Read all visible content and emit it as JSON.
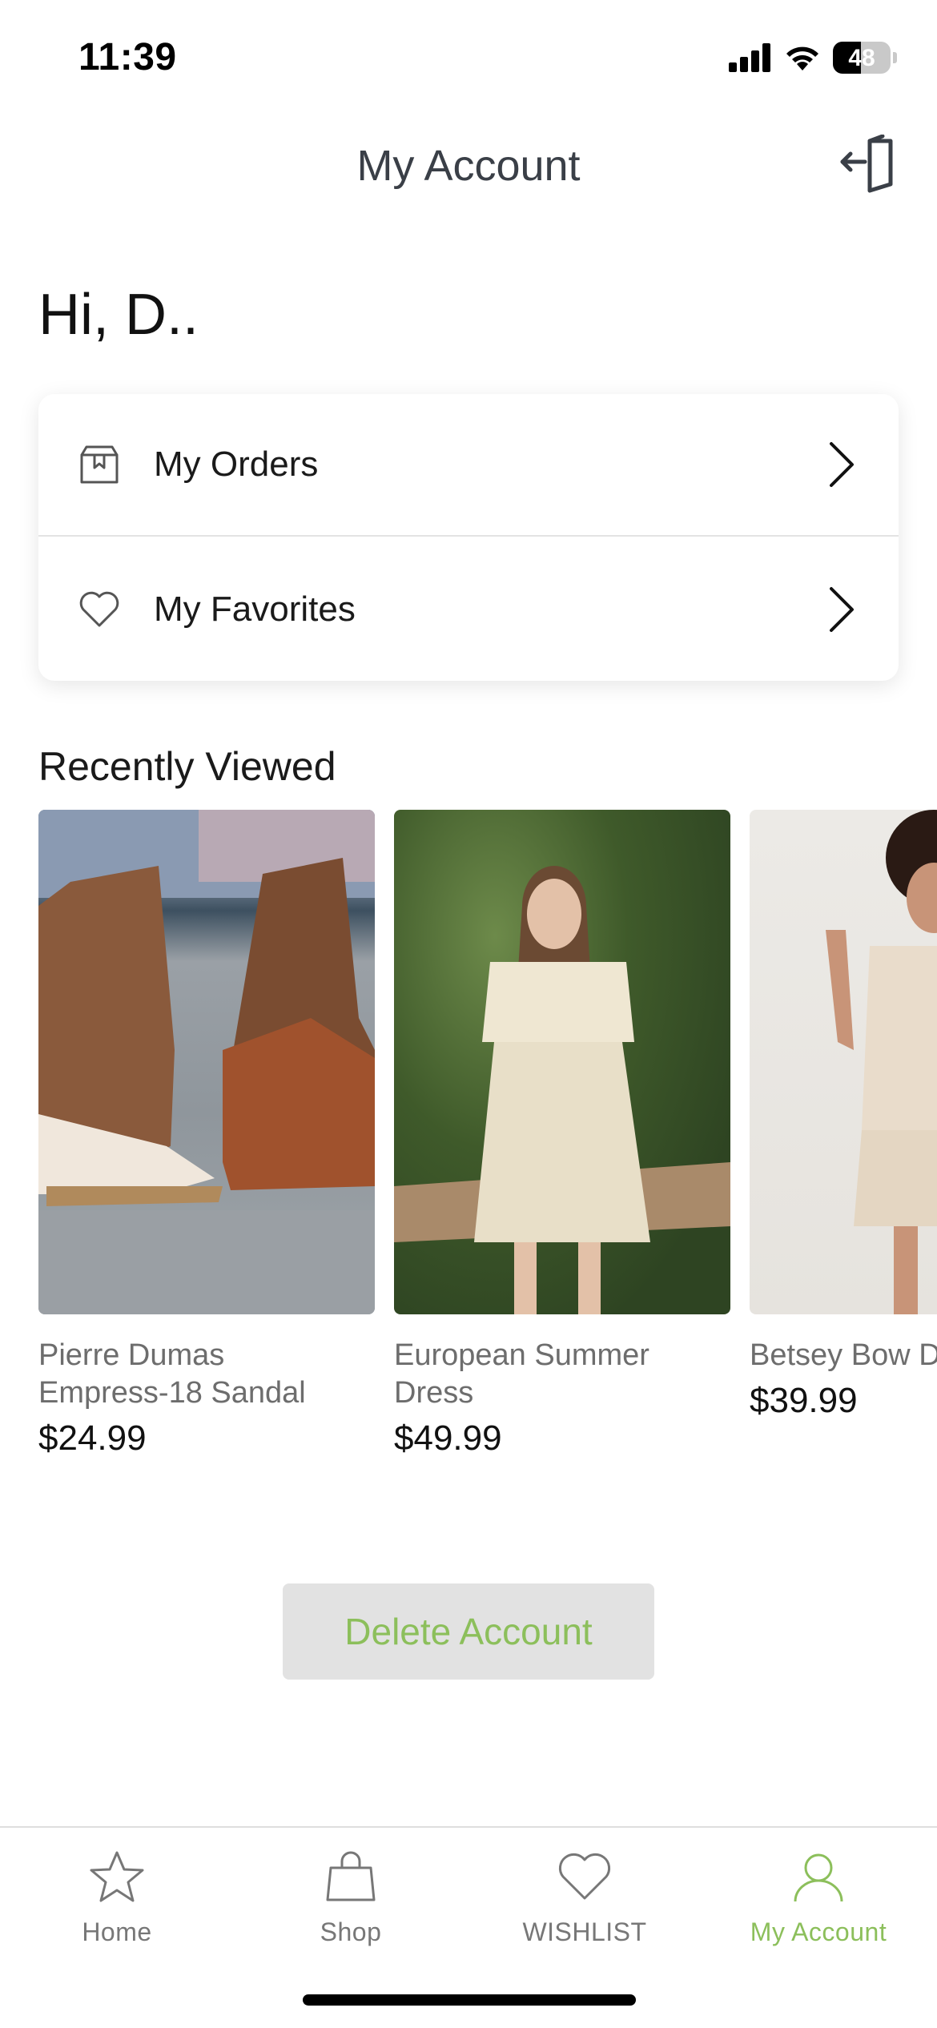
{
  "status_bar": {
    "time": "11:39",
    "battery": "48",
    "battery_level": 0.48
  },
  "header": {
    "title": "My Account"
  },
  "greeting": "Hi,  D..",
  "menu": [
    {
      "label": "My Orders",
      "icon": "orders-box-icon"
    },
    {
      "label": "My Favorites",
      "icon": "heart-icon"
    }
  ],
  "recently_viewed": {
    "title": "Recently Viewed",
    "products": [
      {
        "name": "Pierre Dumas\nEmpress-18 Sandal",
        "price": "$24.99"
      },
      {
        "name": "European Summer\nDress",
        "price": "$49.99"
      },
      {
        "name": "Betsey Bow D",
        "price": "$39.99"
      }
    ]
  },
  "delete_account": "Delete Account",
  "tabs": [
    {
      "label": "Home",
      "icon": "star-icon",
      "active": false
    },
    {
      "label": "Shop",
      "icon": "shopping-bag-icon",
      "active": false
    },
    {
      "label": "WISHLIST",
      "icon": "heart-icon",
      "active": false
    },
    {
      "label": "My Account",
      "icon": "person-icon",
      "active": true
    }
  ],
  "colors": {
    "accent": "#8cbf5b",
    "title": "#3a3f47",
    "button_bg": "#e2e2e2"
  }
}
